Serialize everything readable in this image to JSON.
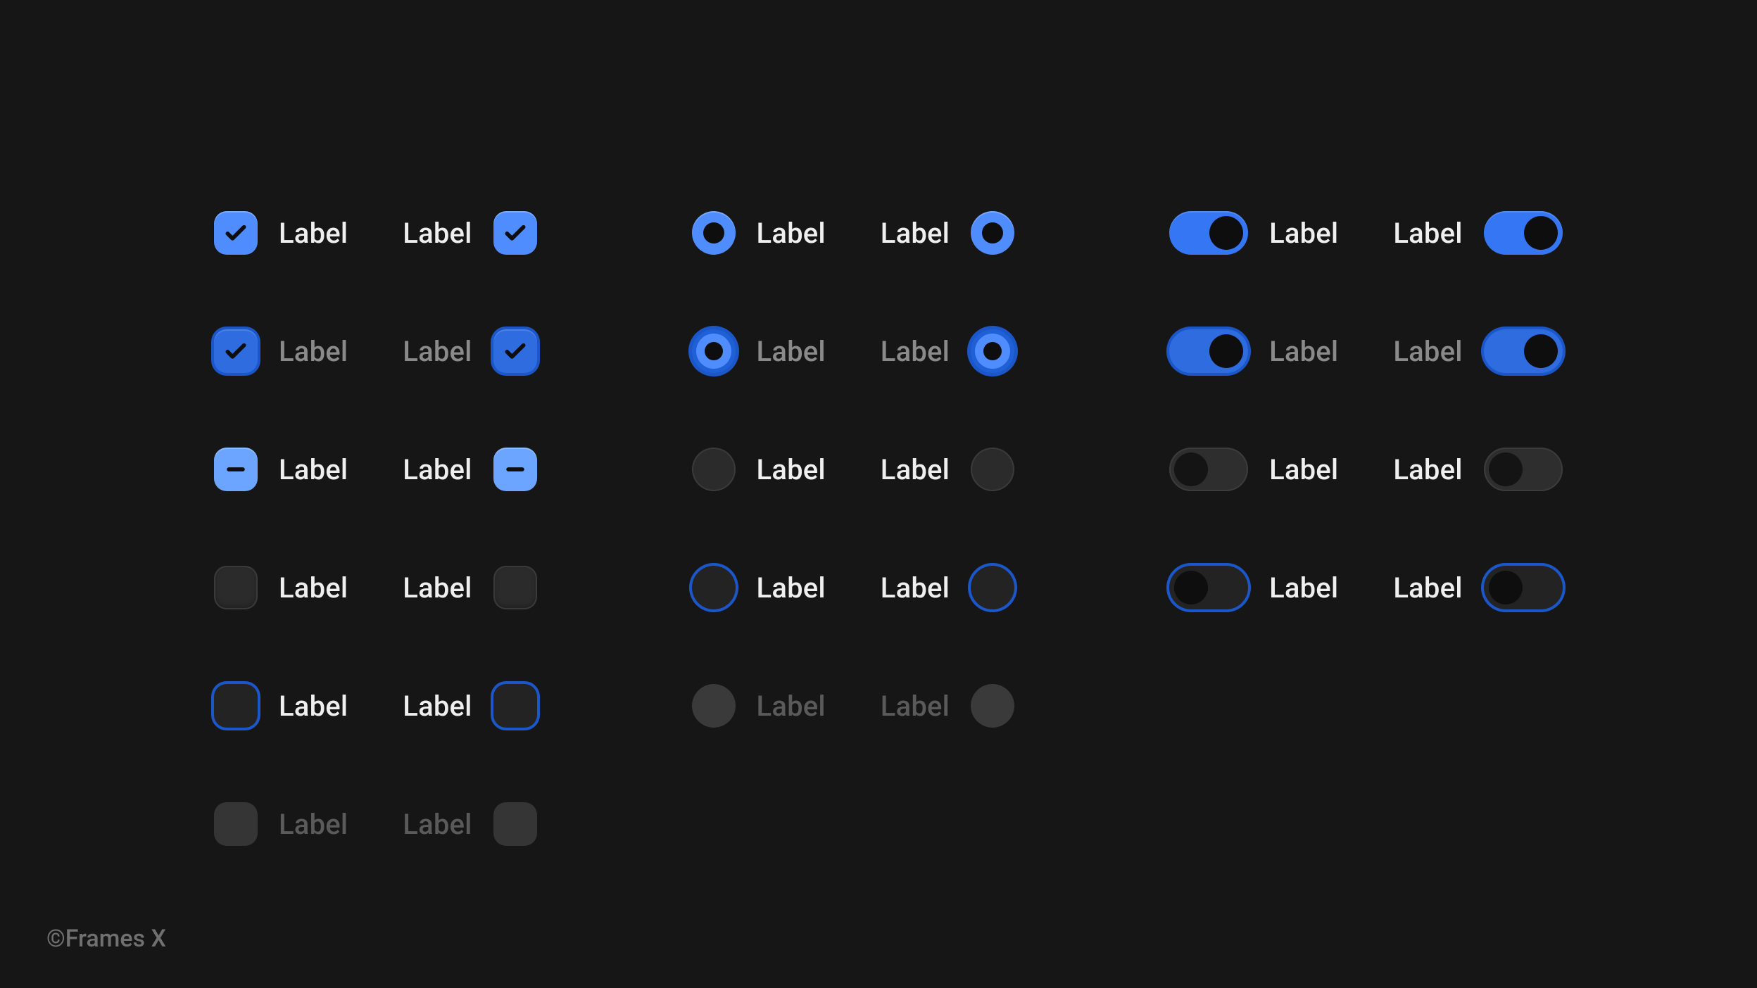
{
  "footer": "©Frames X",
  "checkbox": {
    "rows": [
      {
        "left": "Label",
        "right": "Label"
      },
      {
        "left": "Label",
        "right": "Label"
      },
      {
        "left": "Label",
        "right": "Label"
      },
      {
        "left": "Label",
        "right": "Label"
      },
      {
        "left": "Label",
        "right": "Label"
      },
      {
        "left": "Label",
        "right": "Label"
      }
    ]
  },
  "radio": {
    "rows": [
      {
        "left": "Label",
        "right": "Label"
      },
      {
        "left": "Label",
        "right": "Label"
      },
      {
        "left": "Label",
        "right": "Label"
      },
      {
        "left": "Label",
        "right": "Label"
      },
      {
        "left": "Label",
        "right": "Label"
      }
    ]
  },
  "switch": {
    "rows": [
      {
        "left": "Label",
        "right": "Label"
      },
      {
        "left": "Label",
        "right": "Label"
      },
      {
        "left": "Label",
        "right": "Label"
      },
      {
        "left": "Label",
        "right": "Label"
      }
    ]
  },
  "colors": {
    "accent": "#4f8dff",
    "accentDark": "#2f6ce0",
    "focusRing": "#1b57c9",
    "bg": "#161616",
    "surface": "#2b2b2b",
    "text": "#efefef",
    "textDim": "#8a8a8a",
    "textDisabled": "#5a5a5a"
  }
}
